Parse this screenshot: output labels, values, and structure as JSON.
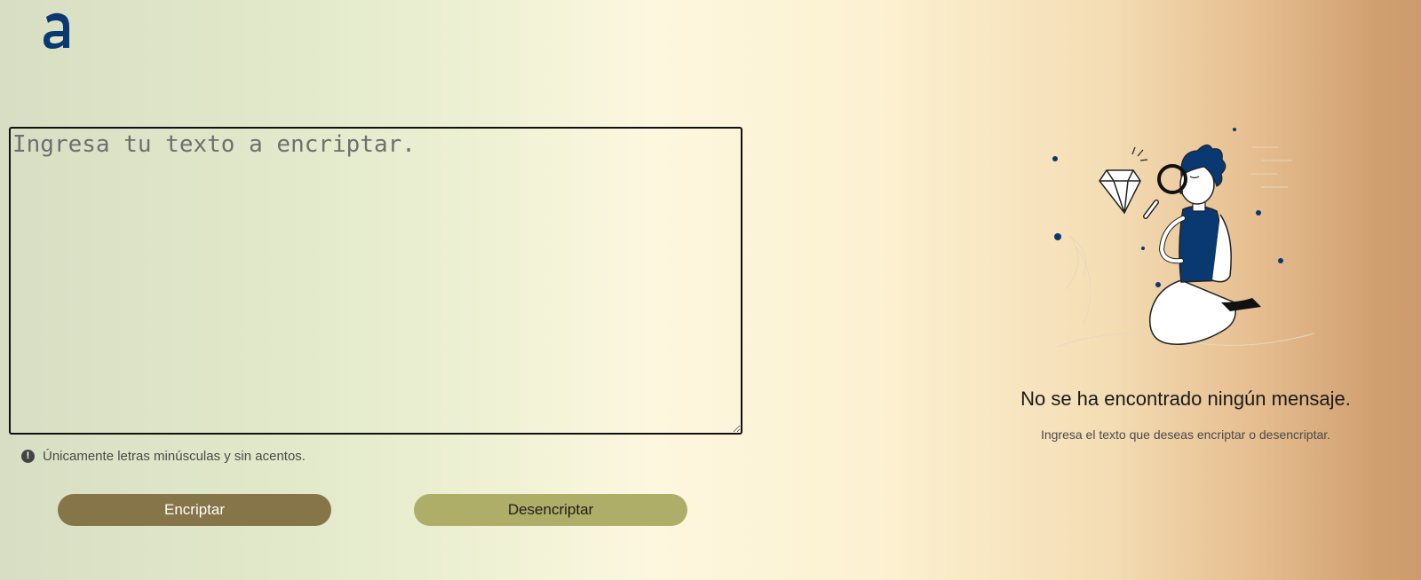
{
  "logo": {
    "text": "a",
    "icon": "alura-logo",
    "color": "#0a3871"
  },
  "input": {
    "placeholder": "Ingresa tu texto a encriptar.",
    "value": ""
  },
  "hint": {
    "icon": "exclamation-circle-icon",
    "text": "Únicamente letras minúsculas y sin acentos."
  },
  "buttons": {
    "encrypt_label": "Encriptar",
    "decrypt_label": "Desencriptar",
    "encrypt_color": "#857548",
    "decrypt_color": "#aeae68"
  },
  "output": {
    "illustration": "person-with-magnifying-glass-illustration",
    "title": "No se ha encontrado ningún mensaje.",
    "subtitle": "Ingresa el texto que deseas encriptar o desencriptar."
  },
  "colors": {
    "accent": "#0a3871"
  }
}
